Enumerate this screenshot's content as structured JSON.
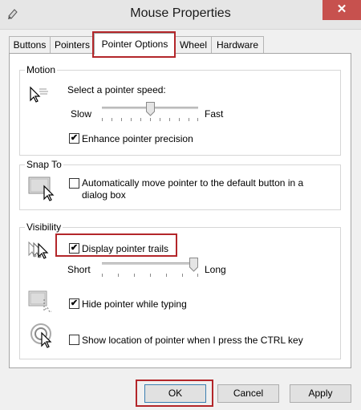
{
  "window": {
    "title": "Mouse Properties",
    "close_glyph": "✕",
    "icon": "mouse-icon"
  },
  "tabs": [
    {
      "label": "Buttons",
      "active": false
    },
    {
      "label": "Pointers",
      "active": false
    },
    {
      "label": "Pointer Options",
      "active": true
    },
    {
      "label": "Wheel",
      "active": false
    },
    {
      "label": "Hardware",
      "active": false
    }
  ],
  "motion": {
    "group_label": "Motion",
    "prompt": "Select a pointer speed:",
    "slow_label": "Slow",
    "fast_label": "Fast",
    "speed_level": 0.5,
    "enhance_label": "Enhance pointer precision",
    "enhance_checked": true
  },
  "snap_to": {
    "group_label": "Snap To",
    "line1": "Automatically move pointer to the default button in a",
    "line2": "dialog box",
    "checked": false
  },
  "visibility": {
    "group_label": "Visibility",
    "trails_label": "Display pointer trails",
    "trails_checked": true,
    "short_label": "Short",
    "long_label": "Long",
    "trail_length_level": 1.0,
    "hide_label": "Hide pointer while typing",
    "hide_checked": true,
    "ctrl_label": "Show location of pointer when I press the CTRL key",
    "ctrl_checked": false
  },
  "buttons": {
    "ok": "OK",
    "cancel": "Cancel",
    "apply": "Apply"
  },
  "colors": {
    "highlight": "#b3262a",
    "close": "#c7514e"
  }
}
